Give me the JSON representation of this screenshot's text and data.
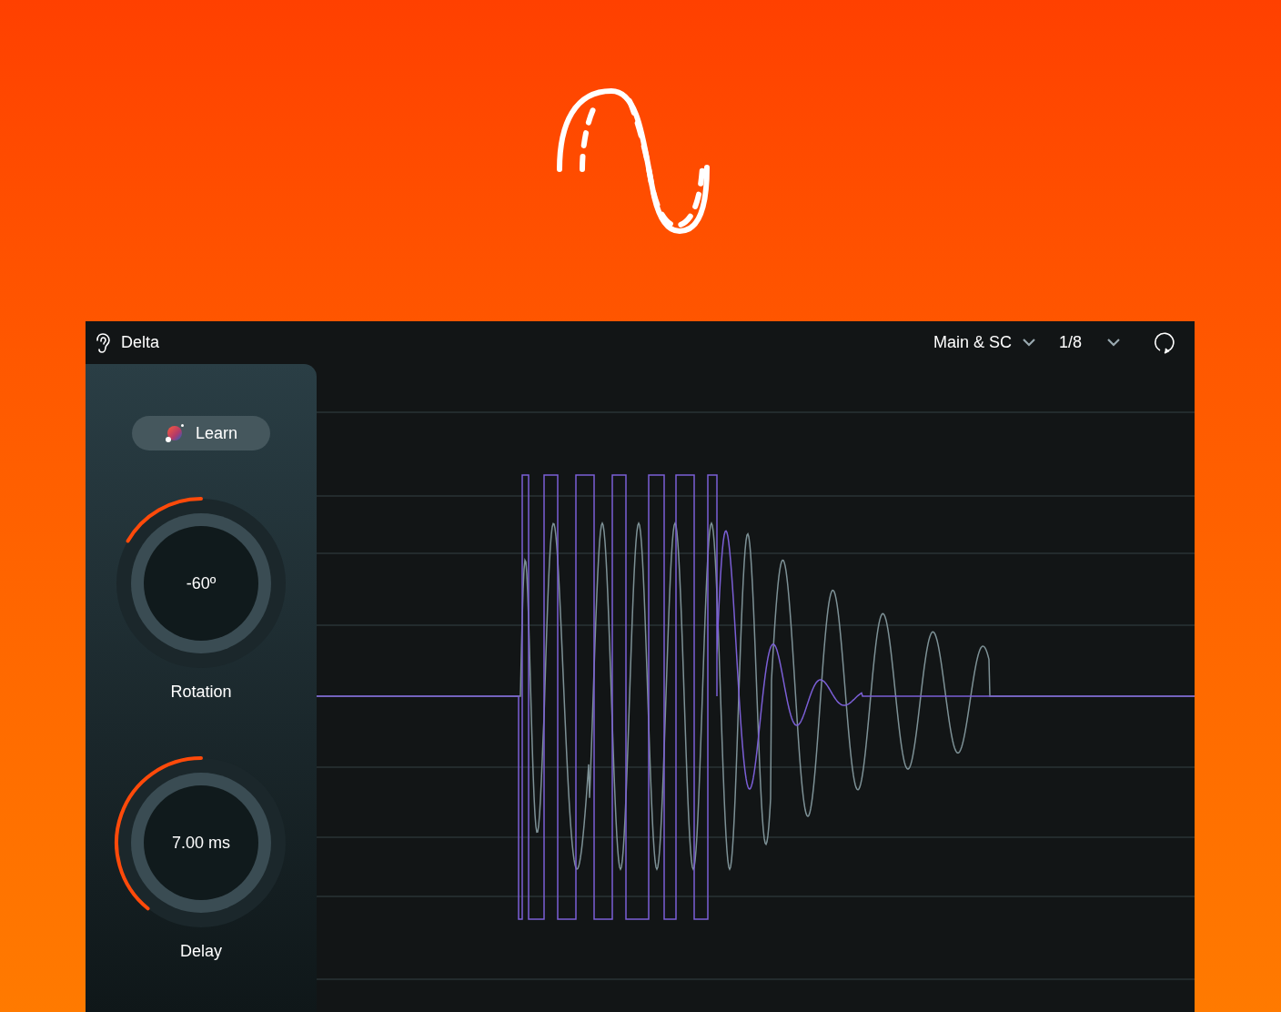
{
  "plugin": {
    "title": "Delta",
    "routing": "Main & SC",
    "rate": "1/8"
  },
  "learn_button": {
    "label": "Learn"
  },
  "knobs": [
    {
      "name": "Rotation",
      "reading": "-60º",
      "level": 0.3
    },
    {
      "name": "Delay",
      "reading": "7.00 ms",
      "level": 0.03
    }
  ]
}
